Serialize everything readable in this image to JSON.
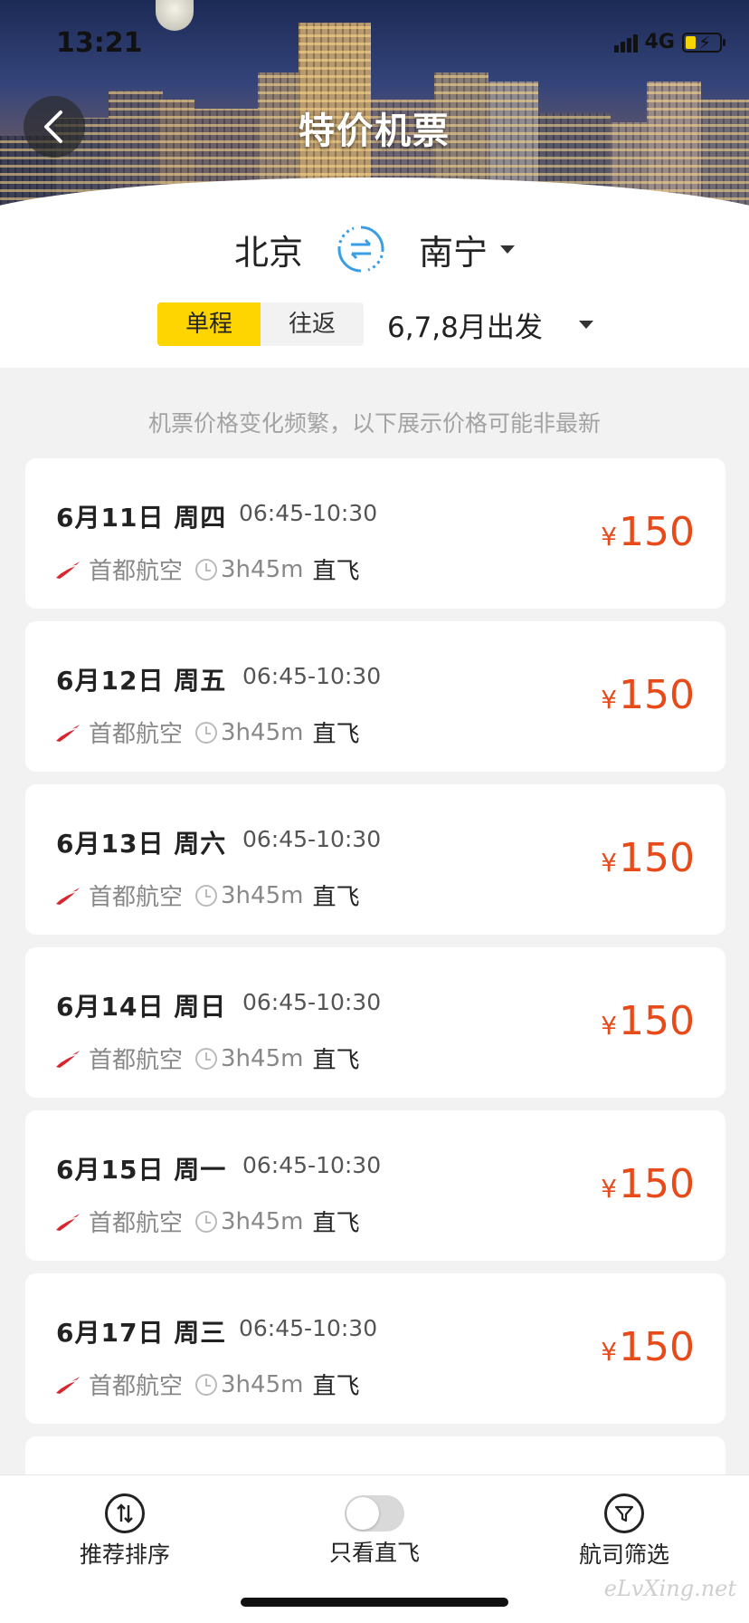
{
  "status_bar": {
    "time": "13:21",
    "network": "4G"
  },
  "header": {
    "title": "特价机票"
  },
  "route": {
    "from": "北京",
    "to": "南宁"
  },
  "trip_type": {
    "one_way": "单程",
    "round_trip": "往返",
    "selected": "单程"
  },
  "departure_months": "6,7,8月出发",
  "notice": "机票价格变化频繁，以下展示价格可能非最新",
  "flights": [
    {
      "date": "6月11日 周四",
      "time": "06:45-10:30",
      "airline": "首都航空",
      "duration": "3h45m",
      "type": "直飞",
      "currency": "¥",
      "price": "150"
    },
    {
      "date": "6月12日 周五",
      "time": "06:45-10:30",
      "airline": "首都航空",
      "duration": "3h45m",
      "type": "直飞",
      "currency": "¥",
      "price": "150"
    },
    {
      "date": "6月13日 周六",
      "time": "06:45-10:30",
      "airline": "首都航空",
      "duration": "3h45m",
      "type": "直飞",
      "currency": "¥",
      "price": "150"
    },
    {
      "date": "6月14日 周日",
      "time": "06:45-10:30",
      "airline": "首都航空",
      "duration": "3h45m",
      "type": "直飞",
      "currency": "¥",
      "price": "150"
    },
    {
      "date": "6月15日 周一",
      "time": "06:45-10:30",
      "airline": "首都航空",
      "duration": "3h45m",
      "type": "直飞",
      "currency": "¥",
      "price": "150"
    },
    {
      "date": "6月17日 周三",
      "time": "06:45-10:30",
      "airline": "首都航空",
      "duration": "3h45m",
      "type": "直飞",
      "currency": "¥",
      "price": "150"
    }
  ],
  "bottom_bar": {
    "sort": "推荐排序",
    "direct_only": "只看直飞",
    "direct_only_on": false,
    "filter": "航司筛选"
  },
  "watermark": "eLvXing.net",
  "colors": {
    "accent_yellow": "#ffd500",
    "price_red": "#e84a1a",
    "swap_blue": "#3a9ee4"
  }
}
